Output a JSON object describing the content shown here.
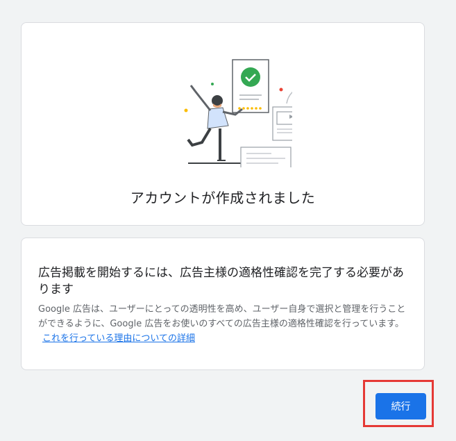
{
  "success_card": {
    "title": "アカウントが作成されました",
    "illustration_icon": "celebration-illustration"
  },
  "info_card": {
    "heading": "広告掲載を開始するには、広告主様の適格性確認を完了する必要があります",
    "description": "Google 広告は、ユーザーにとっての透明性を高め、ユーザー自身で選択と管理を行うことができるように、Google 広告をお使いのすべての広告主様の適格性確認を行っています。",
    "link_text": "これを行っている理由についての詳細"
  },
  "actions": {
    "continue_label": "続行"
  },
  "colors": {
    "primary": "#1a73e8",
    "background": "#f1f3f4",
    "highlight": "#e53935",
    "success_green": "#34a853"
  }
}
